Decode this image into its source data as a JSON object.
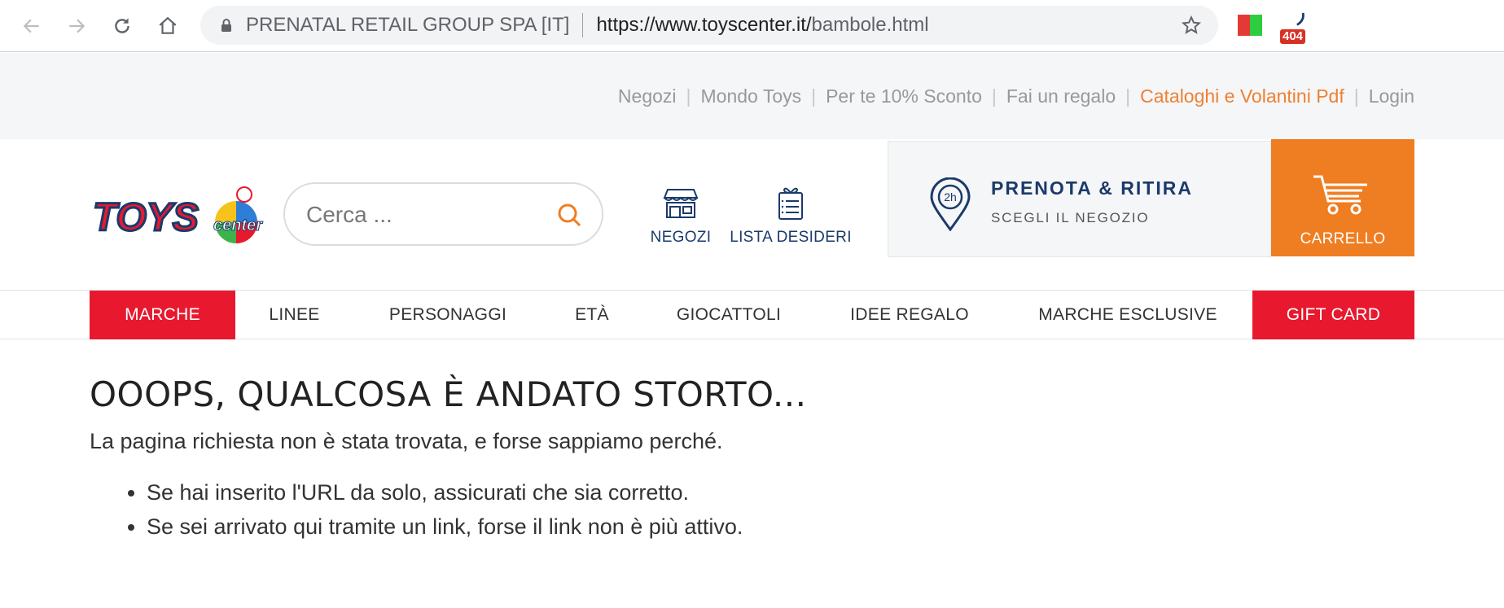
{
  "browser": {
    "cert_label": "PRENATAL RETAIL GROUP SPA [IT]",
    "url_host": "https://www.toyscenter.it/",
    "url_path": "bambole.html",
    "ext_badge": "404"
  },
  "utility_links": [
    "Negozi",
    "Mondo Toys",
    "Per te 10% Sconto",
    "Fai un regalo",
    "Cataloghi e Volantini Pdf",
    "Login"
  ],
  "header": {
    "search_placeholder": "Cerca ...",
    "stores_label": "NEGOZI",
    "wishlist_label": "LISTA DESIDERI",
    "pickup_title": "PRENOTA & RITIRA",
    "pickup_subtitle": "SCEGLI IL NEGOZIO",
    "pickup_badge": "2h",
    "cart_label": "CARRELLO"
  },
  "main_nav": [
    "MARCHE",
    "LINEE",
    "PERSONAGGI",
    "ETÀ",
    "GIOCATTOLI",
    "IDEE REGALO",
    "MARCHE ESCLUSIVE",
    "GIFT CARD"
  ],
  "content": {
    "title": "OOOPS, QUALCOSA È ANDATO STORTO...",
    "lead": "La pagina richiesta non è stata trovata, e forse sappiamo perché.",
    "bullets": [
      "Se hai inserito l'URL da solo, assicurati che sia corretto.",
      "Se sei arrivato qui tramite un link, forse il link non è più attivo."
    ]
  },
  "colors": {
    "accent_red": "#e8192e",
    "accent_orange": "#ef7d21",
    "brand_navy": "#1b3a6b"
  }
}
